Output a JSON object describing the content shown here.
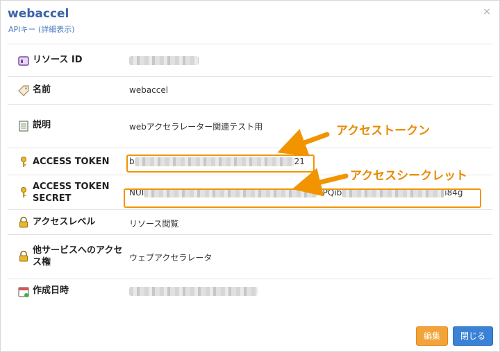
{
  "dialog": {
    "title": "webaccel",
    "subtitle": "APIキー (詳細表示)",
    "close_symbol": "×"
  },
  "rows": [
    {
      "label": "リソース ID",
      "value": "",
      "icon": "id-card-icon",
      "redacted": true
    },
    {
      "label": "名前",
      "value": "webaccel",
      "icon": "tag-icon",
      "redacted": false
    },
    {
      "label": "説明",
      "value": "webアクセラレーター関連テスト用",
      "icon": "notepad-icon",
      "redacted": false
    },
    {
      "label": "ACCESS TOKEN",
      "value_prefix": "b",
      "value_suffix": "21",
      "icon": "key-icon",
      "redacted": true
    },
    {
      "label": "ACCESS TOKEN SECRET",
      "value_prefix": "NUI",
      "value_mid": "oPQib",
      "value_suffix": "i84g",
      "icon": "key-icon",
      "redacted": true
    },
    {
      "label": "アクセスレベル",
      "value": "リソース閲覧",
      "icon": "lock-icon",
      "redacted": false
    },
    {
      "label": "他サービスへのアクセス権",
      "value": "ウェブアクセラレータ",
      "icon": "lock-icon",
      "redacted": false
    },
    {
      "label": "作成日時",
      "value": "",
      "icon": "calendar-icon",
      "redacted": true
    }
  ],
  "annotations": {
    "token": "アクセストークン",
    "secret": "アクセスシークレット"
  },
  "buttons": {
    "edit": "編集",
    "close": "閉じる"
  },
  "colors": {
    "accent_orange": "#f29400",
    "edit_button": "#f2a33a",
    "close_button": "#3a82d6",
    "title_blue": "#3a63a6"
  }
}
